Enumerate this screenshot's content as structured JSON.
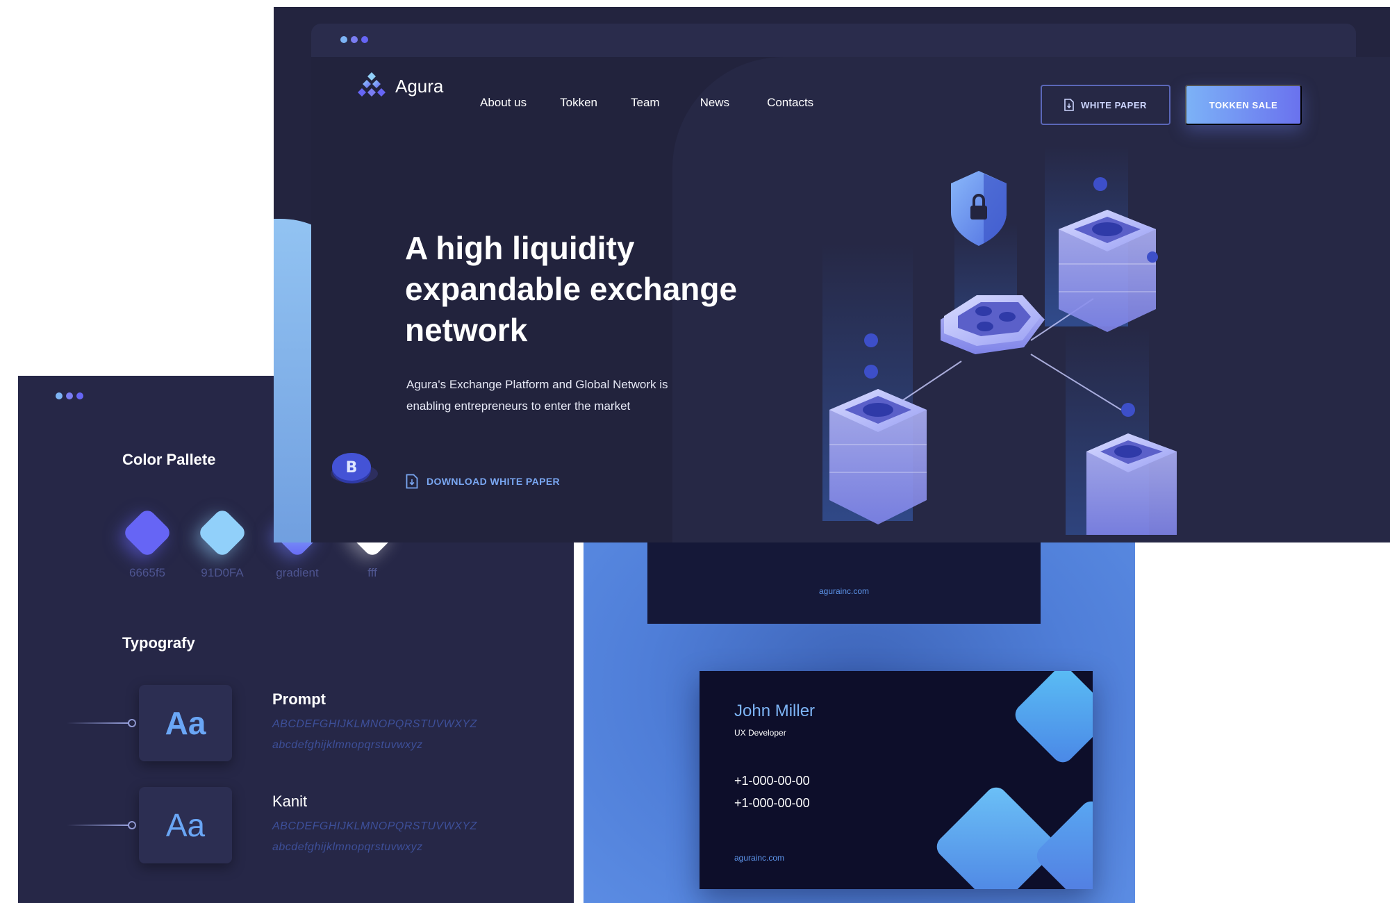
{
  "colors": {
    "background": "#23243f",
    "panel": "#262747",
    "primary": "#6665f5",
    "secondary": "#91D0FA",
    "white": "#ffffff",
    "window_dots": [
      "#7db4f5",
      "#7a7df2",
      "#6665f5"
    ]
  },
  "landing": {
    "brand": "Agura",
    "nav": [
      "About us",
      "Tokken",
      "Team",
      "News",
      "Contacts"
    ],
    "white_paper_button": "WHITE PAPER",
    "token_sale_button": "TOKKEN SALE",
    "headline_lines": [
      "A high liquidity",
      "expandable exchange",
      "network"
    ],
    "subtext_lines": [
      "Agura's Exchange Platform and Global Network is",
      "enabling entrepreneurs to enter the market"
    ],
    "download_link": "DOWNLOAD WHITE PAPER",
    "coin_symbol": "B"
  },
  "style_guide": {
    "color_heading": "Color Pallete",
    "swatches": [
      {
        "code": "6665f5",
        "color": "#6665f5"
      },
      {
        "code": "91D0FA",
        "color": "#91D0FA"
      },
      {
        "code": "gradient",
        "color": "linear-gradient(135deg,#91D0FA,#6665f5)"
      },
      {
        "code": "fff",
        "color": "#ffffff"
      }
    ],
    "type_heading": "Typografy",
    "fonts": [
      {
        "sample": "Aa",
        "name": "Prompt",
        "upper": "ABCDEFGHIJKLMNOPQRSTUVWXYZ",
        "lower": "abcdefghijklmnopqrstuvwxyz"
      },
      {
        "sample": "Aa",
        "name": "Kanit",
        "upper": "ABCDEFGHIJKLMNOPQRSTUVWXYZ",
        "lower": "abcdefghijklmnopqrstuvwxyz"
      }
    ]
  },
  "business_cards": {
    "top_card_url": "agurainc.com",
    "name": "John Miller",
    "role": "UX Developer",
    "phones": [
      "+1-000-00-00",
      "+1-000-00-00"
    ],
    "url": "agurainc.com"
  }
}
